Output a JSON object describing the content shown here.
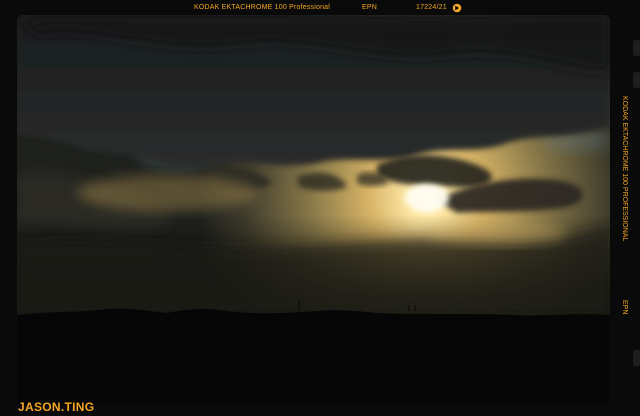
{
  "film_edge_top": {
    "stock": "KODAK EKTACHROME 100 Professional",
    "code": "EPN",
    "frame": "17224/21",
    "arrow_icon": "frame-arrow-icon"
  },
  "film_edge_side": {
    "stock": "KODAK EKTACHROME 100 PROFESSIONAL",
    "code": "EPN"
  },
  "signature": "JASON.TING",
  "colors": {
    "edge_text": "#f5a623",
    "film_base": "#0a0a0a",
    "sky_glow": "#ffe9a8",
    "silhouette": "#060606"
  }
}
